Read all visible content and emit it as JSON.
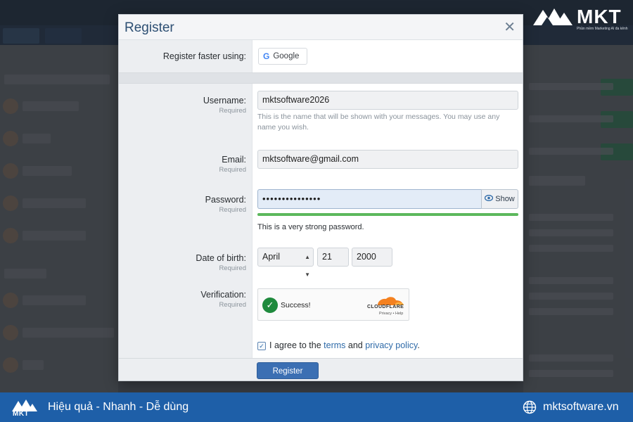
{
  "brand": {
    "name": "MKT",
    "subtitle": "Phần mềm Marketing AI đa kênh"
  },
  "modal": {
    "title": "Register",
    "close_glyph": "✕"
  },
  "register_faster": {
    "label": "Register faster using:",
    "google_glyph": "G",
    "google_label": "Google"
  },
  "fields": {
    "required_text": "Required",
    "username": {
      "label": "Username:",
      "value": "mktsoftware2026",
      "hint": "This is the name that will be shown with your messages. You may use any name you wish."
    },
    "email": {
      "label": "Email:",
      "value": "mktsoftware@gmail.com"
    },
    "password": {
      "label": "Password:",
      "value": "•••••••••••••••",
      "show_label": "Show",
      "strength_text": "This is a very strong password.",
      "strength_fraction": 1.0
    },
    "dob": {
      "label": "Date of birth:",
      "month": "April",
      "day": "21",
      "year": "2000"
    },
    "verification": {
      "label": "Verification:",
      "status": "Success!",
      "provider": "CLOUDFLARE",
      "links": "Privacy • Help"
    }
  },
  "agree": {
    "checked_glyph": "✓",
    "prefix": "I agree to the ",
    "terms": "terms",
    "and": " and ",
    "privacy": "privacy policy",
    "suffix": "."
  },
  "footer": {
    "register_label": "Register"
  },
  "bottombar": {
    "logo_text": "MKT",
    "tagline": "Hiệu quả - Nhanh - Dễ dùng",
    "website": "mktsoftware.vn"
  },
  "colors": {
    "accent": "#3b6fb3",
    "title": "#2d4f73",
    "strength": "#5cb85c",
    "bottombar": "#1e5fa8"
  }
}
